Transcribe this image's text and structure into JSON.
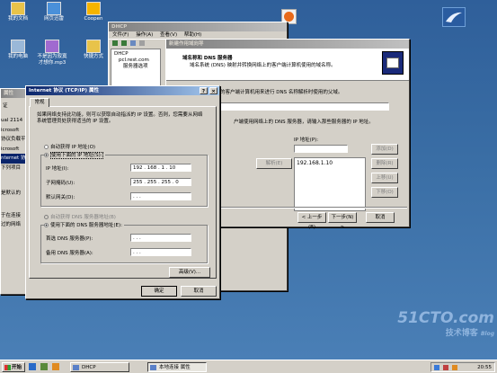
{
  "desktop": {
    "icons": [
      {
        "label": "我的文档",
        "color": "#e8c34a"
      },
      {
        "label": "网页迅雷",
        "color": "#4a90d9"
      },
      {
        "label": "Coopen",
        "color": "#f5b400"
      },
      {
        "label": "我的电脑",
        "color": "#9ab8d8"
      },
      {
        "label": "不是因为寂寞才想你.mp3",
        "color": "#a06ad0"
      },
      {
        "label": "快捷方式",
        "color": "#e8c34a"
      }
    ],
    "watermark_main": "51CTO.com",
    "watermark_sub": "技术博客",
    "watermark_tag": "Blog"
  },
  "dhcp": {
    "title": "DHCP",
    "menu": [
      "文件(F)",
      "操作(A)",
      "查看(V)",
      "帮助(H)"
    ],
    "tree": [
      "DHCP",
      "pcl.rest.com",
      "服务器选项"
    ]
  },
  "wizard": {
    "title": "新建作用域向导",
    "header_title": "域名称和 DNS 服务器",
    "header_desc": "域名系统 (DNS) 映射并转换网络上的客户端计算机使用的域名称。",
    "line1": "的客户端计算机用来进行 DNS 名称解析时使用的父域。",
    "line2": "户端使用网络上的 DNS 服务器，请输入那些服务器的 IP 地址。",
    "ip_header": "IP 地址(P):",
    "resolve": "解析(E)",
    "list_items": [
      "192.168.1.10"
    ],
    "side_buttons": [
      "添加(D)",
      "删除(R)",
      "上移(U)",
      "下移(O)"
    ],
    "back": "< 上一步(B)",
    "next": "下一步(N) >",
    "cancel": "取消"
  },
  "bgwin": {
    "title": "属性",
    "tab": "证",
    "items": [
      "ual 2114",
      "icrosoft",
      "协议负载平",
      "icrosoft",
      "nternet 协",
      "下列项目",
      "是默认的",
      "于在连接",
      "过的网络"
    ]
  },
  "tcpip": {
    "title": "Internet 协议 (TCP/IP) 属性",
    "help": "?",
    "close": "×",
    "tab": "常规",
    "intro": "如果网络支持此功能，则可以获取自动指派的 IP 设置。否则，您需要从网络系统管理员处获得适当的 IP 设置。",
    "auto_ip": "自动获得 IP 地址(O)",
    "manual_ip": "使用下面的 IP 地址(S):",
    "ip_label": "IP 地址(I):",
    "ip_value": "192 . 168 .  1  . 10",
    "mask_label": "子网掩码(U):",
    "mask_value": "255 . 255 . 255 .  0",
    "gw_label": "默认网关(D):",
    "gw_value": " .  .  .",
    "auto_dns": "自动获得 DNS 服务器地址(B)",
    "manual_dns": "使用下面的 DNS 服务器地址(E):",
    "dns1_label": "首选 DNS 服务器(P):",
    "dns1_value": " .  .  .",
    "dns2_label": "备用 DNS 服务器(A):",
    "dns2_value": " .  .  .",
    "advanced": "高级(V)...",
    "ok": "确定",
    "cancel": "取消"
  },
  "taskbar": {
    "start": "开始",
    "tasks": [
      "DHCP",
      "本地连接 属性"
    ],
    "clock": "20:55"
  }
}
